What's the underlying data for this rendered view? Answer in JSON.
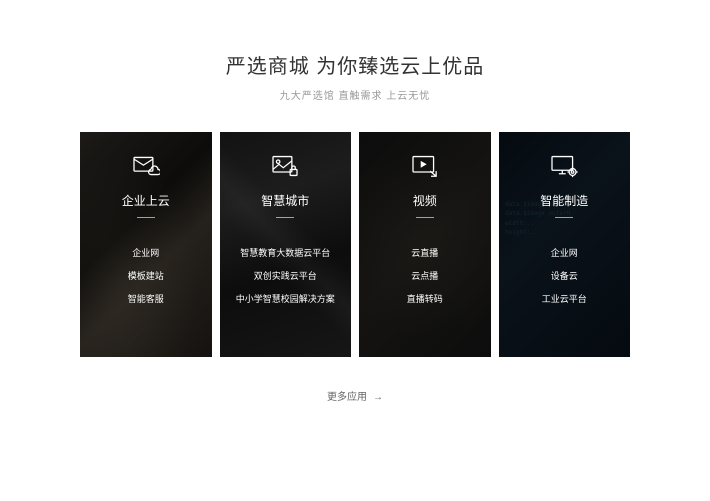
{
  "header": {
    "title": "严选商城 为你臻选云上优品",
    "subtitle": "九大严选馆 直触需求 上云无忧"
  },
  "cards": [
    {
      "icon": "envelope-cloud-icon",
      "title": "企业上云",
      "items": [
        "企业网",
        "模板建站",
        "智能客服"
      ]
    },
    {
      "icon": "image-lock-icon",
      "title": "智慧城市",
      "items": [
        "智慧教育大数据云平台",
        "双创实践云平台",
        "中小学智慧校园解决方案"
      ]
    },
    {
      "icon": "video-play-icon",
      "title": "视频",
      "items": [
        "云直播",
        "云点播",
        "直播转码"
      ]
    },
    {
      "icon": "display-gear-icon",
      "title": "智能制造",
      "items": [
        "企业网",
        "设备云",
        "工业云平台"
      ]
    }
  ],
  "more": {
    "label": "更多应用",
    "arrow": "→"
  }
}
